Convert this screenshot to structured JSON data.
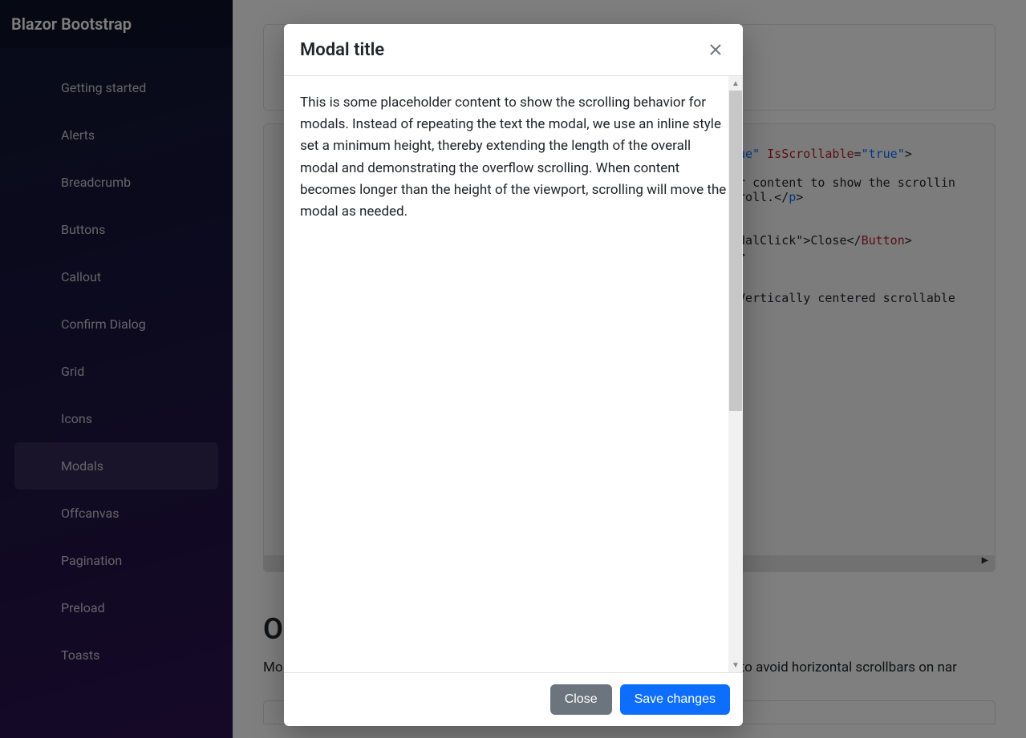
{
  "brand": "Blazor Bootstrap",
  "sidebar": {
    "items": [
      {
        "label": "Getting started"
      },
      {
        "label": "Alerts"
      },
      {
        "label": "Breadcrumb"
      },
      {
        "label": "Buttons"
      },
      {
        "label": "Callout"
      },
      {
        "label": "Confirm Dialog"
      },
      {
        "label": "Grid"
      },
      {
        "label": "Icons"
      },
      {
        "label": "Modals"
      },
      {
        "label": "Offcanvas"
      },
      {
        "label": "Pagination"
      },
      {
        "label": "Preload"
      },
      {
        "label": "Toasts"
      }
    ],
    "active_index": 8
  },
  "code": {
    "frag1_attrval": "rue\"",
    "frag1_attr": "IsScrollable",
    "frag1_eq": "=",
    "frag1_val": "\"true\"",
    "frag1_close": ">",
    "frag2_a": "er content to show the scrollin",
    "frag2_b": "croll.</",
    "frag2_tag": "p",
    "frag2_c": ">",
    "frag3_a": "odalClick\"",
    "frag3_b": ">Close</",
    "frag3_tag": "Button",
    "frag3_c": ">",
    "frag4_a": "n",
    "frag4_b": ">",
    "frag5_a": ">Vertically centered scrollable"
  },
  "scroll_hint": "▶",
  "section": {
    "title_char": "O",
    "text_prefix": "Mo",
    "text_suffix": " to avoid horizontal scrollbars on nar"
  },
  "modal": {
    "title": "Modal title",
    "body": "This is some placeholder content to show the scrolling behavior for modals. Instead of repeating the text the modal, we use an inline style set a minimum height, thereby extending the length of the overall modal and demonstrating the overflow scrolling. When content becomes longer than the height of the viewport, scrolling will move the modal as needed.",
    "close_label": "Close",
    "save_label": "Save changes"
  }
}
